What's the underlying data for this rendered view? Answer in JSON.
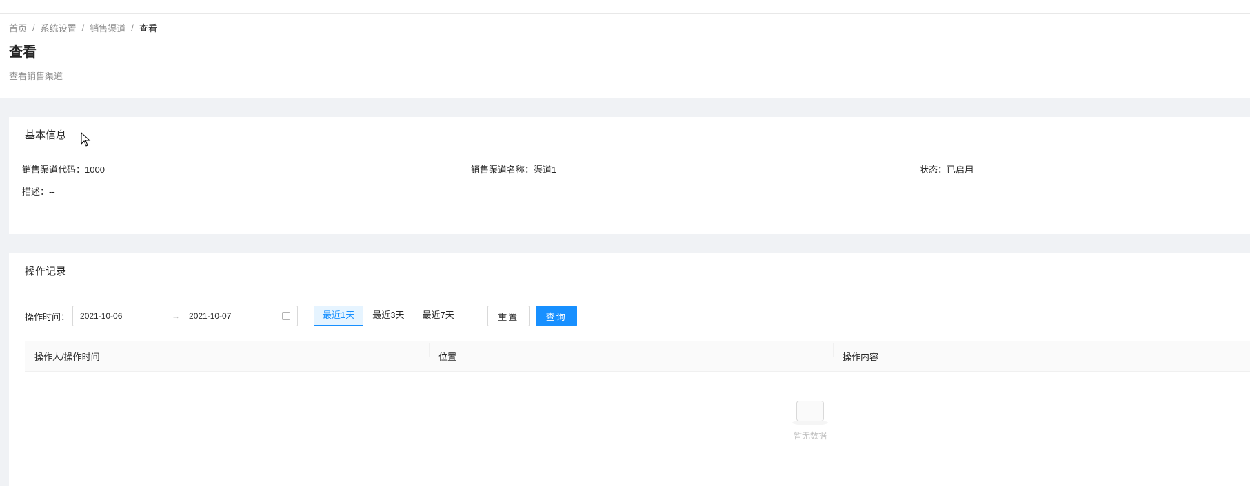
{
  "breadcrumb": [
    "首页",
    "系统设置",
    "销售渠道",
    "查看"
  ],
  "page": {
    "title": "查看",
    "description": "查看销售渠道"
  },
  "basic_info": {
    "title": "基本信息",
    "code_label": "销售渠道代码：",
    "code_value": "1000",
    "name_label": "销售渠道名称：",
    "name_value": "渠道1",
    "status_label": "状态：",
    "status_value": "已启用",
    "desc_label": "描述：",
    "desc_value": "--"
  },
  "operation_log": {
    "title": "操作记录",
    "time_label": "操作时间：",
    "start_date": "2021-10-06",
    "range_arrow": "→",
    "end_date": "2021-10-07",
    "quick_ranges": [
      "最近1天",
      "最近3天",
      "最近7天"
    ],
    "active_quick_range": "最近1天",
    "reset_label": "重置",
    "query_label": "查询",
    "columns": [
      "操作人/操作时间",
      "位置",
      "操作内容"
    ],
    "empty_text": "暂无数据"
  },
  "colors": {
    "primary": "#1890ff",
    "background": "#f0f2f5"
  }
}
